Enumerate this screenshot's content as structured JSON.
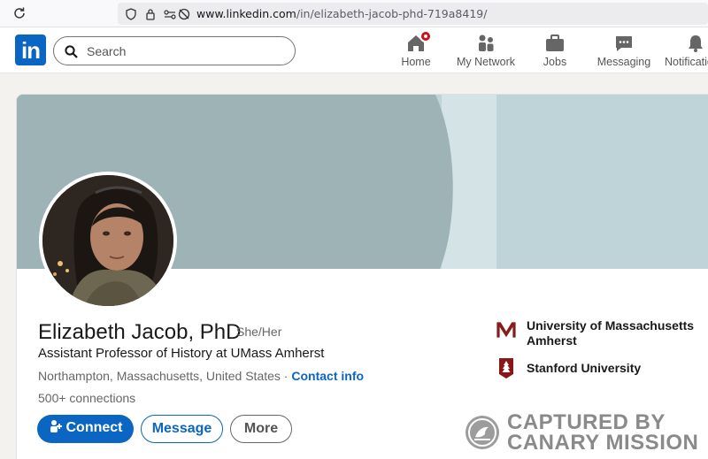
{
  "browser": {
    "url_host": "www.linkedin.com",
    "url_path": "/in/elizabeth-jacob-phd-719a8419/"
  },
  "nav": {
    "logo_text": "in",
    "search_placeholder": "Search",
    "items": [
      {
        "label": "Home",
        "icon": "home-icon"
      },
      {
        "label": "My Network",
        "icon": "network-icon"
      },
      {
        "label": "Jobs",
        "icon": "briefcase-icon"
      },
      {
        "label": "Messaging",
        "icon": "message-icon"
      },
      {
        "label": "Notifications",
        "icon": "bell-icon"
      }
    ]
  },
  "profile": {
    "name": "Elizabeth Jacob, PhD",
    "pronouns": "She/Her",
    "headline": "Assistant Professor of History at UMass Amherst",
    "location": "Northampton, Massachusetts, United States",
    "separator": " · ",
    "contact_info": "Contact info",
    "connections": "500+ connections",
    "buttons": {
      "connect": "Connect",
      "message": "Message",
      "more": "More"
    },
    "education": [
      {
        "name_line1": "University of Massachusetts",
        "name_line2": "Amherst",
        "logo": "umass-logo",
        "color": "#881c1c"
      },
      {
        "name_line1": "Stanford University",
        "name_line2": "",
        "logo": "stanford-logo",
        "color": "#8c1515"
      }
    ]
  },
  "watermark": {
    "line1": "CAPTURED BY",
    "line2": "CANARY MISSION"
  },
  "colors": {
    "linkedin_blue": "#0a66c2",
    "banner_primary": "#9eb3b6",
    "banner_light": "#bfd4d9"
  }
}
